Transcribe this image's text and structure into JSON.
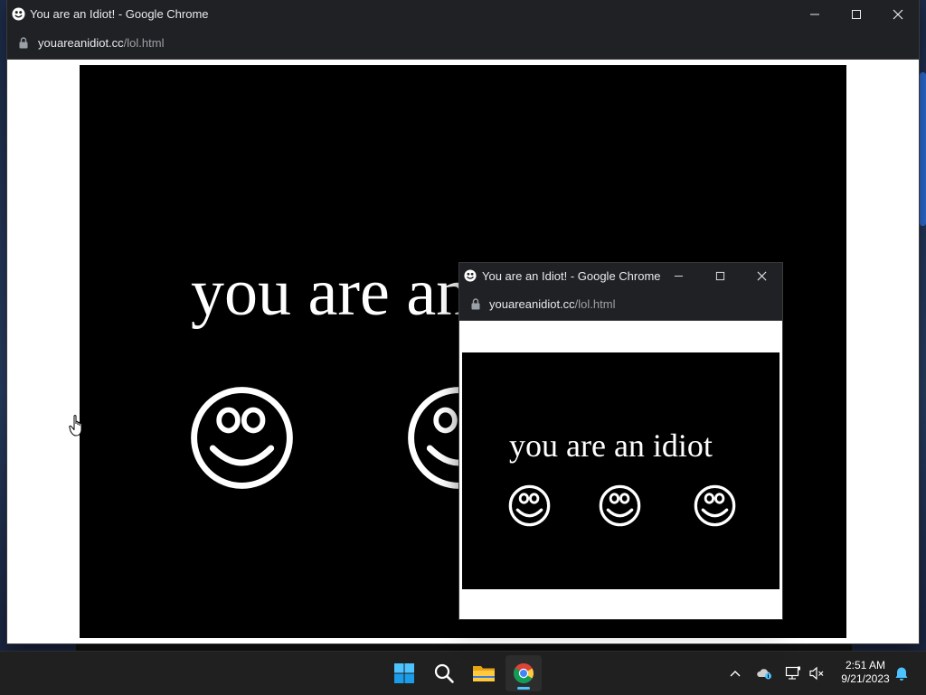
{
  "main_window": {
    "title": "You are an Idiot! - Google Chrome",
    "url_host": "youareanidiot.cc",
    "url_path": "/lol.html",
    "page_text": "you are an idiot"
  },
  "popup_window": {
    "title": "You are an Idiot! - Google Chrome",
    "url_host": "youareanidiot.cc",
    "url_path": "/lol.html",
    "page_text": "you are an idiot"
  },
  "taskbar": {
    "start_icon": "windows-start-icon",
    "search_icon": "search-icon",
    "explorer_icon": "file-explorer-icon",
    "chrome_icon": "chrome-icon"
  },
  "clock": {
    "time": "2:51 AM",
    "date": "9/21/2023"
  },
  "colors": {
    "chrome_frame": "#202124",
    "page_background": "#000000",
    "taskbar": "#202020",
    "accent": "#4cc2ff"
  }
}
